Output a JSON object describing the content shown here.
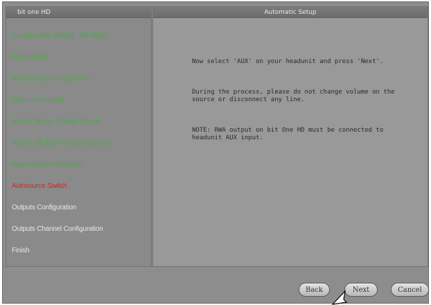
{
  "window": {
    "left_title": "bit one HD",
    "right_title": "Automatic Setup"
  },
  "menu": [
    {
      "label": "Configuration Wizard - 8R Mode",
      "color": "#4fa64a"
    },
    {
      "label": "Inputs Setup",
      "color": "#4fa64a"
    },
    {
      "label": "Master Input Configuration",
      "color": "#4fa64a"
    },
    {
      "label": "Input Level Setup",
      "color": "#4fa64a"
    },
    {
      "label": "Master Delay / Polarity Check",
      "color": "#4fa64a"
    },
    {
      "label": "Master DE-EQ / Phase Alignment",
      "color": "#4fa64a"
    },
    {
      "label": "Input Analysis (Deskew)",
      "color": "#4fa64a"
    },
    {
      "label": "Autosource Switch",
      "color": "#d42424"
    },
    {
      "label": "Outputs Configuration",
      "color": "#e6e6e6"
    },
    {
      "label": "Outputs Channel Configuration",
      "color": "#e6e6e6"
    },
    {
      "label": "Finish",
      "color": "#e6e6e6"
    }
  ],
  "message": {
    "line1": "Now select 'AUX' on your headunit and press 'Next'.",
    "line2": "During the process, please do not change volume on the source or disconnect any line.",
    "line3": "NOTE: RWA output on bit One HD must be connected to headunit AUX input."
  },
  "buttons": {
    "back": "Back",
    "next": "Next",
    "cancel": "Cancel"
  }
}
